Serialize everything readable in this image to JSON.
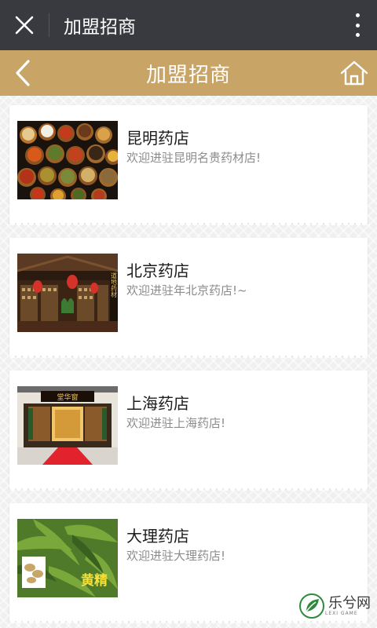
{
  "wechat_bar": {
    "title": "加盟招商"
  },
  "header": {
    "title": "加盟招商"
  },
  "stores": [
    {
      "name": "昆明药店",
      "desc": "欢迎进驻昆明名贵药材店!"
    },
    {
      "name": "北京药店",
      "desc": "欢迎进驻年北京药店!~"
    },
    {
      "name": "上海药店",
      "desc": "欢迎进驻上海药店!"
    },
    {
      "name": "大理药店",
      "desc": "欢迎进驻大理药店!"
    }
  ],
  "images": {
    "beijing_sign": "道地药材",
    "shanghai_sign": "堂华窗",
    "dali_overlay": "黄精"
  },
  "watermark": {
    "name": "乐兮网",
    "sub": "LEXI GAME"
  },
  "colors": {
    "wechat_bar": "#393a3f",
    "header": "#c8a567",
    "card": "#ffffff"
  }
}
